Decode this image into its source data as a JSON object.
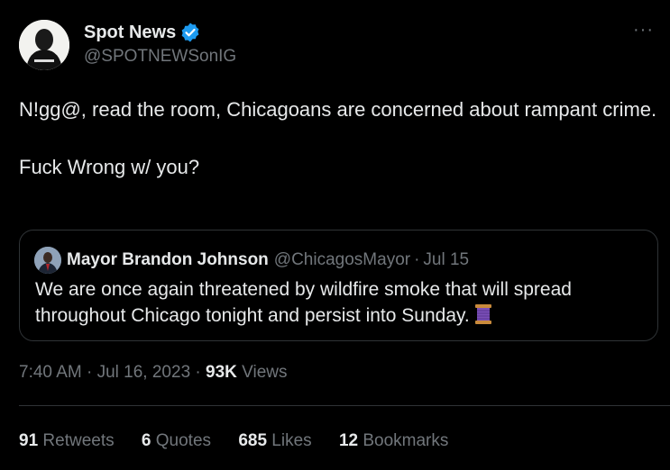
{
  "author": {
    "display_name": "Spot News",
    "handle": "@SPOTNEWSonIG",
    "verified_icon": "verified-badge-icon",
    "avatar_icon": "avatar-image"
  },
  "more_icon": "···",
  "tweet": {
    "line1": "N!gg@, read the room, Chicagoans are concerned about rampant crime.",
    "line2": "Fuck Wrong w/ you?"
  },
  "quote": {
    "display_name": "Mayor Brandon Johnson",
    "handle": "@ChicagosMayor",
    "separator": "·",
    "date": "Jul 15",
    "text": "We are once again threatened by wildfire smoke that will spread throughout Chicago tonight and persist into Sunday.",
    "emoji_icon": "thread-spool-icon"
  },
  "meta": {
    "time": "7:40 AM",
    "separator1": " · ",
    "date": "Jul 16, 2023",
    "separator2": " · ",
    "views_count": "93K",
    "views_label": " Views"
  },
  "stats": [
    {
      "count": "91",
      "label": "Retweets"
    },
    {
      "count": "6",
      "label": "Quotes"
    },
    {
      "count": "685",
      "label": "Likes"
    },
    {
      "count": "12",
      "label": "Bookmarks"
    }
  ],
  "colors": {
    "background": "#000000",
    "text": "#e7e9ea",
    "secondary": "#71767b",
    "border": "#2f3336",
    "verified": "#1d9bf0"
  }
}
